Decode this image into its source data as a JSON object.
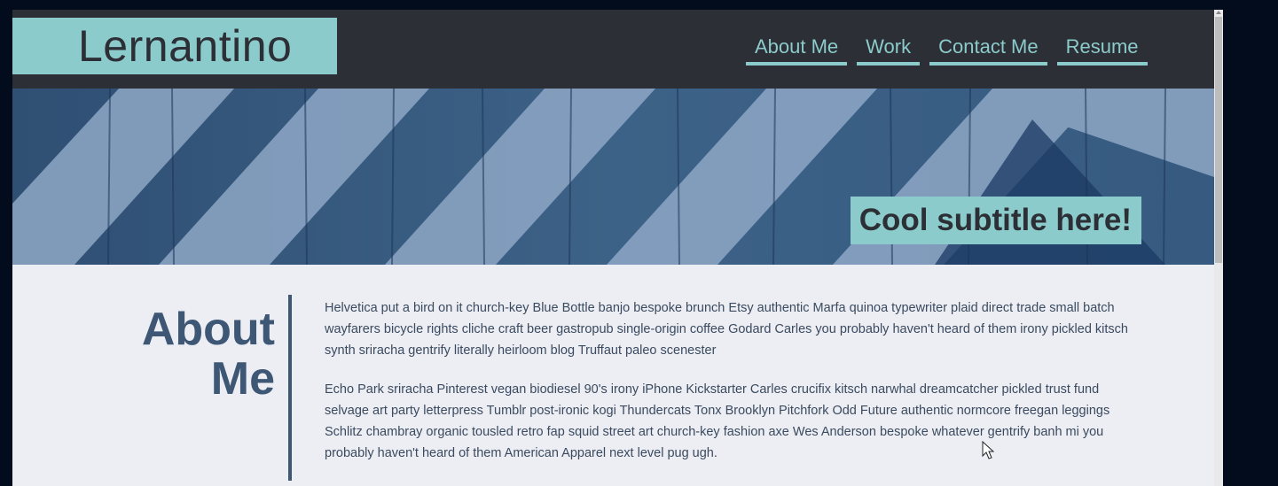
{
  "header": {
    "logo": "Lernantino",
    "nav": [
      "About Me",
      "Work",
      "Contact Me",
      "Resume"
    ]
  },
  "hero": {
    "subtitle": "Cool subtitle here!"
  },
  "about": {
    "heading_line1": "About",
    "heading_line2": "Me",
    "paragraphs": [
      "Helvetica put a bird on it church-key Blue Bottle banjo bespoke brunch Etsy authentic Marfa quinoa typewriter plaid direct trade small batch wayfarers bicycle rights cliche craft beer gastropub single-origin coffee Godard Carles you probably haven't heard of them irony pickled kitsch synth sriracha gentrify literally heirloom blog Truffaut paleo scenester",
      "Echo Park sriracha Pinterest vegan biodiesel 90's irony iPhone Kickstarter Carles crucifix kitsch narwhal dreamcatcher pickled trust fund selvage art party letterpress Tumblr post-ironic kogi Thundercats Tonx Brooklyn Pitchfork Odd Future authentic normcore freegan leggings Schlitz chambray organic tousled retro fap squid street art church-key fashion axe Wes Anderson bespoke whatever gentrify banh mi you probably haven't heard of them American Apparel next level pug ugh."
    ]
  },
  "colors": {
    "accent": "#8ccbcb",
    "header_bg": "#2c2f35",
    "heading": "#3e5775",
    "page_bg": "#eceef4",
    "outer_bg": "#020c1c"
  }
}
